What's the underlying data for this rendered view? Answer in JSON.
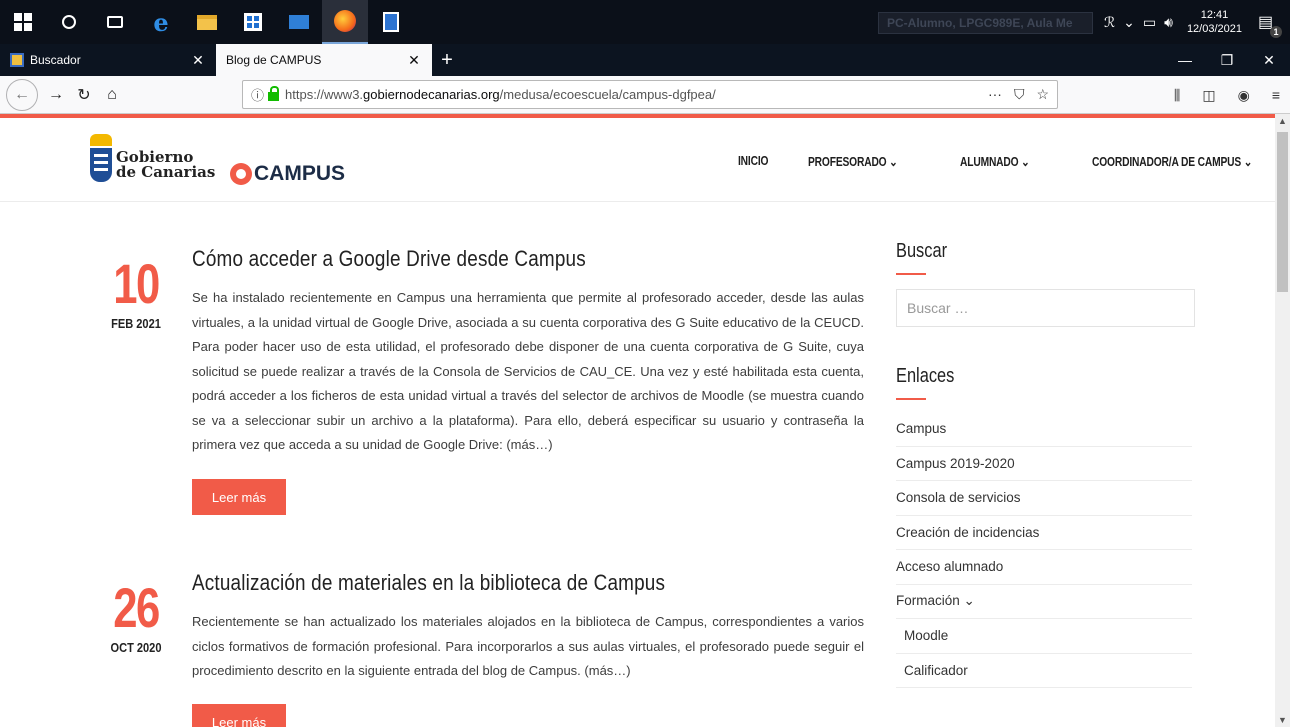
{
  "taskbar": {
    "search_box_text": "PC-Alumno, LPGC989E, Aula Me",
    "clock_time": "12:41",
    "clock_date": "12/03/2021",
    "notification_count": "1"
  },
  "tabs": [
    {
      "title": "Buscador"
    },
    {
      "title": "Blog de CAMPUS"
    }
  ],
  "url": {
    "prefix": "https://www3.",
    "domain": "gobiernodecanarias.org",
    "path": "/medusa/ecoescuela/campus-dgfpea/"
  },
  "site": {
    "logo_line1": "Gobierno",
    "logo_line2": "de Canarias",
    "campus_logo": "CAMPUS",
    "menu": [
      "INICIO",
      "PROFESORADO ⌄",
      "ALUMNADO ⌄",
      "COORDINADOR/A DE CAMPUS ⌄"
    ]
  },
  "posts": [
    {
      "day": "10",
      "month": "FEB 2021",
      "title": "Cómo acceder a Google Drive desde Campus",
      "excerpt": "Se ha instalado recientemente en Campus una herramienta que permite al profesorado acceder, desde las aulas virtuales, a la unidad virtual de Google Drive, asociada a su cuenta corporativa des G Suite educativo de la CEUCD. Para poder hacer uso de esta utilidad, el profesorado debe disponer de una cuenta corporativa de G Suite, cuya solicitud se puede realizar a través de la Consola de Servicios de CAU_CE. Una vez y esté habilitada esta cuenta, podrá acceder a los ficheros de esta unidad virtual a través del selector de archivos de Moodle (se muestra cuando se va a seleccionar subir un archivo a la plataforma). Para ello, deberá especificar su usuario y contraseña la primera vez que acceda a su unidad de Google Drive: (más…)",
      "button": "Leer más"
    },
    {
      "day": "26",
      "month": "OCT 2020",
      "title": "Actualización de materiales en la biblioteca de Campus",
      "excerpt": "Recientemente se han actualizado los materiales alojados en la biblioteca de Campus, correspondientes a varios ciclos formativos de formación profesional. Para incorporarlos a sus aulas virtuales, el profesorado puede seguir el procedimiento descrito en la siguiente entrada del blog de Campus. (más…)",
      "button": "Leer más"
    }
  ],
  "sidebar": {
    "search_title": "Buscar",
    "search_placeholder": "Buscar …",
    "links_title": "Enlaces",
    "links": [
      "Campus",
      "Campus 2019-2020",
      "Consola de servicios",
      "Creación de incidencias",
      "Acceso alumnado",
      "Formación ⌄"
    ],
    "sublinks": [
      "Moodle",
      "Calificador"
    ]
  },
  "colors": {
    "accent": "#f15b48",
    "taskbar": "#0b1019"
  }
}
